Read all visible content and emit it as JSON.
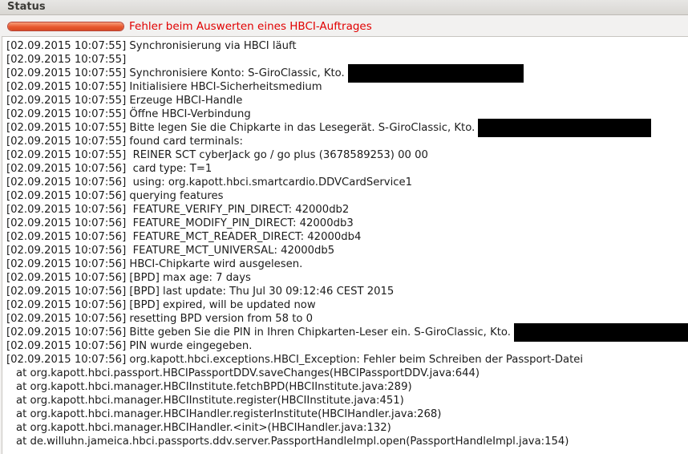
{
  "header": {
    "title": "Status"
  },
  "status": {
    "progress_fraction": 1.0,
    "error_message": "Fehler beim Auswerten eines HBCI-Auftrages",
    "accent_color": "#e8582e",
    "error_color": "#e10000"
  },
  "log": {
    "lines": [
      "[02.09.2015 10:07:55] Synchronisierung via HBCI läuft",
      "[02.09.2015 10:07:55]",
      "[02.09.2015 10:07:55] Synchronisiere Konto: S-GiroClassic, Kto.",
      "[02.09.2015 10:07:55] Initialisiere HBCI-Sicherheitsmedium",
      "[02.09.2015 10:07:55] Erzeuge HBCI-Handle",
      "[02.09.2015 10:07:55] Öffne HBCI-Verbindung",
      "[02.09.2015 10:07:55] Bitte legen Sie die Chipkarte in das Lesegerät. S-GiroClassic, Kto.",
      "[02.09.2015 10:07:55] found card terminals:",
      "[02.09.2015 10:07:55]  REINER SCT cyberJack go / go plus (3678589253) 00 00",
      "[02.09.2015 10:07:56]  card type: T=1",
      "[02.09.2015 10:07:56]  using: org.kapott.hbci.smartcardio.DDVCardService1",
      "[02.09.2015 10:07:56] querying features",
      "[02.09.2015 10:07:56]  FEATURE_VERIFY_PIN_DIRECT: 42000db2",
      "[02.09.2015 10:07:56]  FEATURE_MODIFY_PIN_DIRECT: 42000db3",
      "[02.09.2015 10:07:56]  FEATURE_MCT_READER_DIRECT: 42000db4",
      "[02.09.2015 10:07:56]  FEATURE_MCT_UNIVERSAL: 42000db5",
      "[02.09.2015 10:07:56] HBCI-Chipkarte wird ausgelesen.",
      "[02.09.2015 10:07:56] [BPD] max age: 7 days",
      "[02.09.2015 10:07:56] [BPD] last update: Thu Jul 30 09:12:46 CEST 2015",
      "[02.09.2015 10:07:56] [BPD] expired, will be updated now",
      "[02.09.2015 10:07:56] resetting BPD version from 58 to 0",
      "[02.09.2015 10:07:56] Bitte geben Sie die PIN in Ihren Chipkarten-Leser ein. S-GiroClassic, Kto.",
      "[02.09.2015 10:07:56] PIN wurde eingegeben.",
      "[02.09.2015 10:07:56] org.kapott.hbci.exceptions.HBCI_Exception: Fehler beim Schreiben der Passport-Datei"
    ],
    "trace": [
      "at org.kapott.hbci.passport.HBCIPassportDDV.saveChanges(HBCIPassportDDV.java:644)",
      "at org.kapott.hbci.manager.HBCIInstitute.fetchBPD(HBCIInstitute.java:289)",
      "at org.kapott.hbci.manager.HBCIInstitute.register(HBCIInstitute.java:451)",
      "at org.kapott.hbci.manager.HBCIHandler.registerInstitute(HBCIHandler.java:268)",
      "at org.kapott.hbci.manager.HBCIHandler.<init>(HBCIHandler.java:132)",
      "at de.willuhn.jameica.hbci.passports.ddv.server.PassportHandleImpl.open(PassportHandleImpl.java:154)"
    ]
  }
}
